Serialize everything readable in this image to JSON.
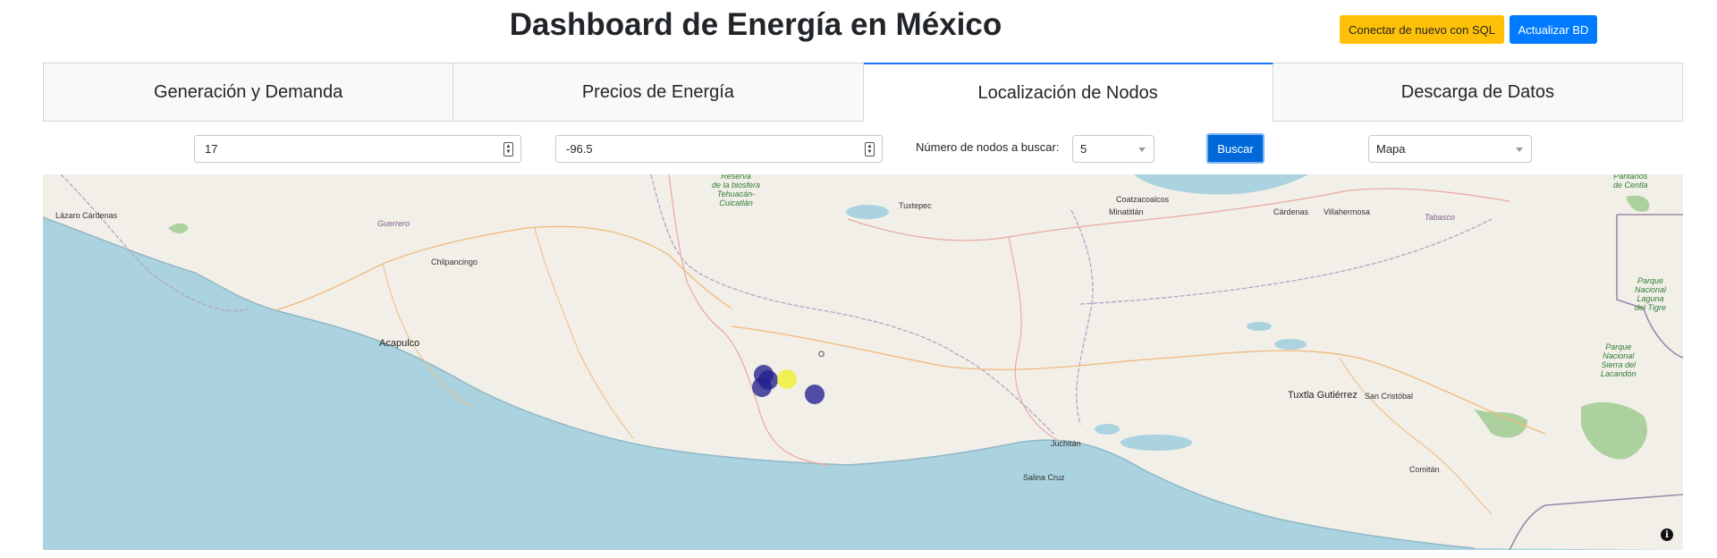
{
  "header": {
    "title": "Dashboard de Energía en México",
    "connect_sql_label": "Conectar de nuevo con SQL",
    "update_db_label": "Actualizar BD"
  },
  "tabs": [
    {
      "label": "Generación y Demanda",
      "active": false
    },
    {
      "label": "Precios de Energía",
      "active": false
    },
    {
      "label": "Localización de Nodos",
      "active": true
    },
    {
      "label": "Descarga de Datos",
      "active": false
    }
  ],
  "controls": {
    "latitude_value": "17",
    "longitude_value": "-96.5",
    "nodes_label": "Número de nodos a buscar:",
    "nodes_selected": "5",
    "search_label": "Buscar",
    "view_selected": "Mapa"
  },
  "map": {
    "labels": {
      "lazaro_cardenas": "Lázaro Cárdenas",
      "guerrero": "Guerrero",
      "chilpancingo": "Chilpancingo",
      "acapulco": "Acapulco",
      "reserva": "Reserva\nde la biosfera\nTehuacán-\nCuicatlán",
      "tuxtepec": "Tuxtepec",
      "coatzacoalcos": "Coatzacoalcos",
      "minatitlan": "Minatitlán",
      "cardenas": "Cárdenas",
      "villahermosa": "Villahermosa",
      "tabasco": "Tabasco",
      "pantanos": "Pantanos\nde Centla",
      "laguna_tigre": "Parque\nNacional\nLaguna\ndel Tigre",
      "sierra_lacandon": "Parque\nNacional\nSierra del\nLacandón",
      "tuxtla": "Tuxtla Gutiérrez",
      "san_cristobal": "San Cristóbal",
      "juchitan": "Juchitán",
      "salina_cruz": "Salina Cruz",
      "comitan": "Comitán",
      "oaxaca_partial": "O"
    },
    "markers": [
      {
        "lat": 17.08,
        "lon": -96.77,
        "color": "#241f8e"
      },
      {
        "lat": 17.03,
        "lon": -96.74,
        "color": "#241f8e"
      },
      {
        "lat": 16.97,
        "lon": -96.78,
        "color": "#241f8e"
      },
      {
        "lat": 17.04,
        "lon": -96.6,
        "color": "#f0f02a"
      },
      {
        "lat": 16.9,
        "lon": -96.4,
        "color": "#241f8e"
      }
    ],
    "colors": {
      "sea": "#aad3df",
      "land": "#f2efe9",
      "node_primary": "#241f8e",
      "node_selected": "#f0f02a"
    }
  }
}
